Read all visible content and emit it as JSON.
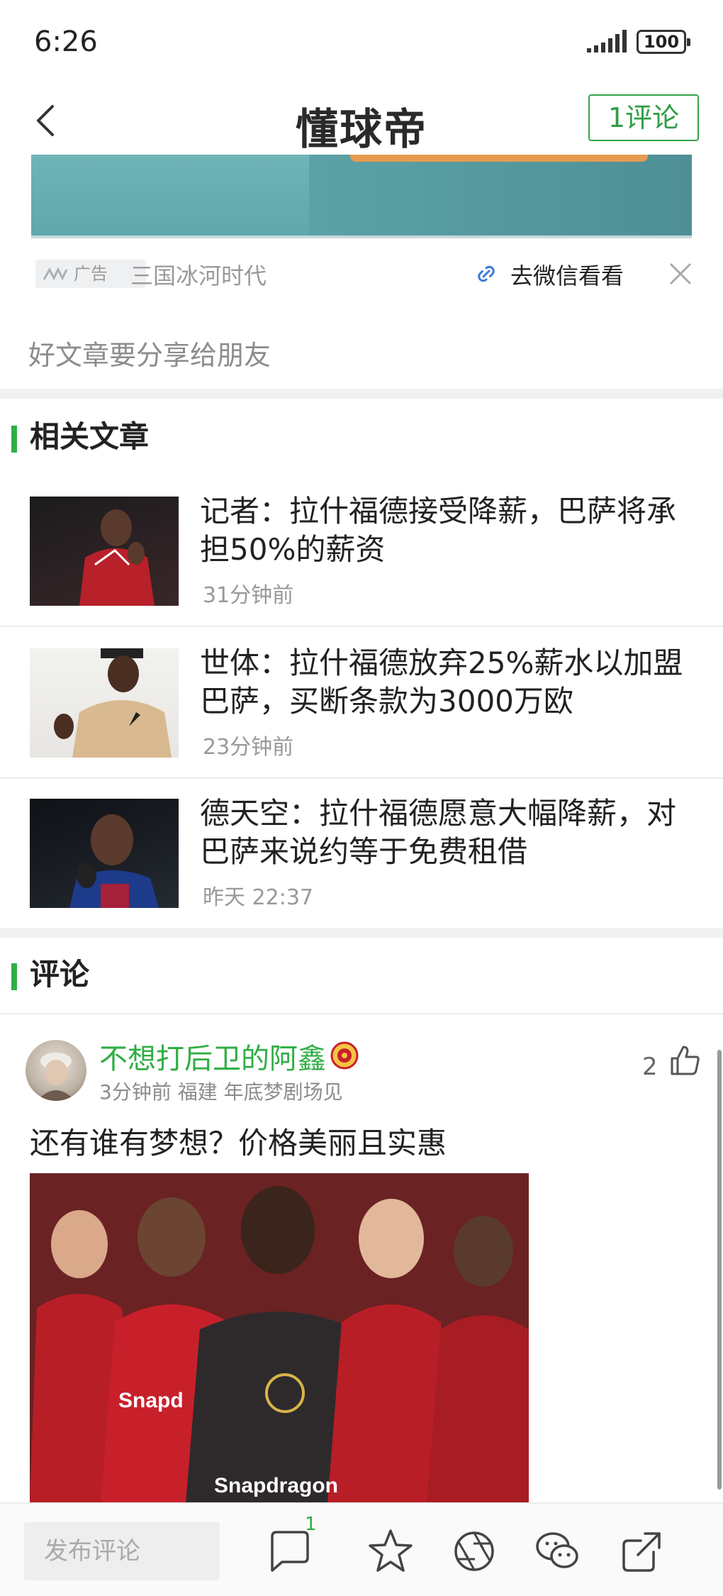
{
  "status": {
    "time": "6:26",
    "battery": "100"
  },
  "header": {
    "logo": "懂球帝",
    "comment_button": "1评论"
  },
  "ad": {
    "badge": "广告",
    "title": "三国冰河时代",
    "link": "去微信看看"
  },
  "share_text": "好文章要分享给朋友",
  "related": {
    "title": "相关文章",
    "articles": [
      {
        "title": "记者：拉什福德接受降薪，巴萨将承担50%的薪资",
        "time": "31分钟前"
      },
      {
        "title": "世体：拉什福德放弃25%薪水以加盟巴萨，买断条款为3000万欧",
        "time": "23分钟前"
      },
      {
        "title": "德天空：拉什福德愿意大幅降薪，对巴萨来说约等于免费租借",
        "time": "昨天 22:37"
      }
    ]
  },
  "comments": {
    "title": "评论",
    "items": [
      {
        "user": "不想打后卫的阿鑫",
        "meta": "3分钟前 福建 年底梦剧场见",
        "likes": "2",
        "text": "还有谁有梦想？价格美丽且实惠"
      }
    ]
  },
  "bottom": {
    "input_placeholder": "发布评论",
    "comment_badge": "1"
  },
  "colors": {
    "accent": "#2fae44",
    "text": "#222222",
    "muted": "#999999"
  }
}
